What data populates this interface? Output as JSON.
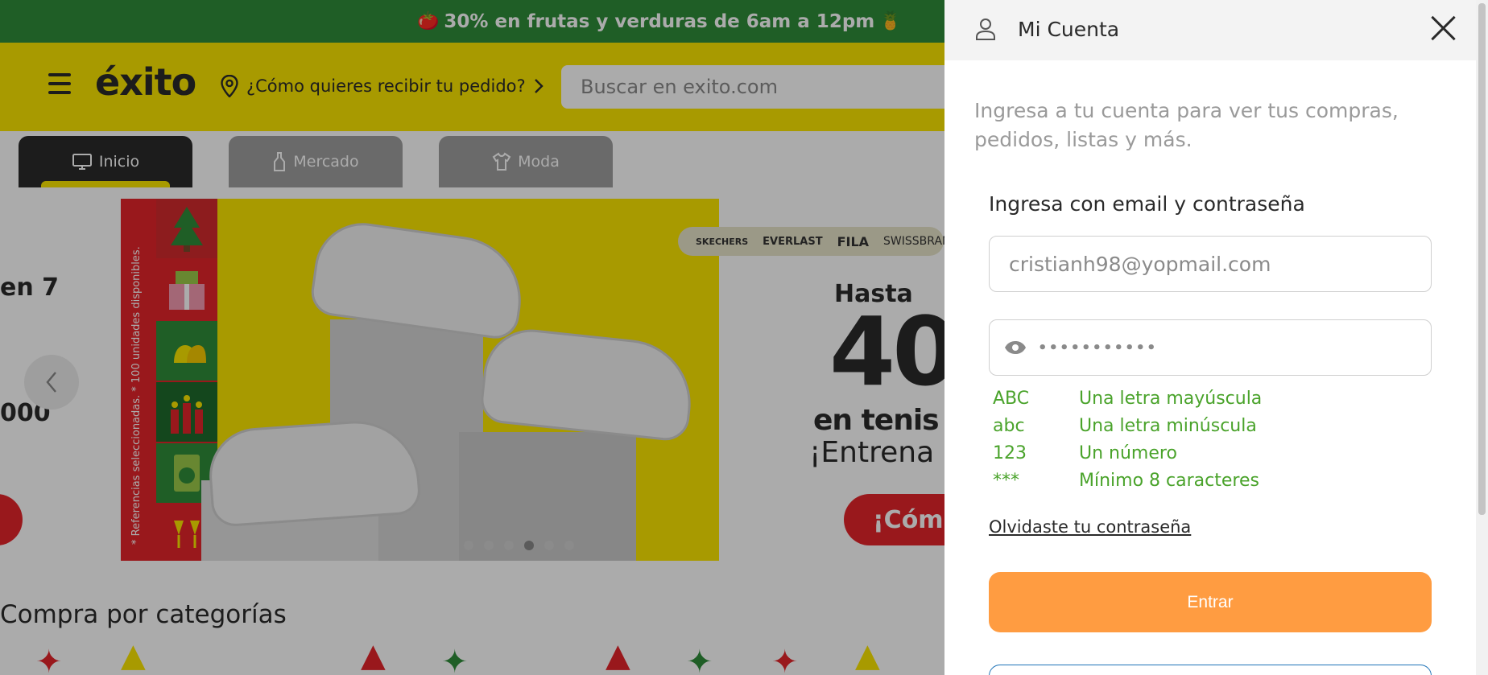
{
  "promo_bar": {
    "text": "30% en frutas y verduras de 6am a 12pm",
    "lead_emoji": "🍅",
    "tail_emoji": "🍍"
  },
  "header": {
    "logo": "éxito",
    "delivery_prompt": "¿Cómo quieres recibir tu pedido?",
    "search_placeholder": "Buscar en exito.com"
  },
  "tabs": [
    {
      "label": "Inicio",
      "icon": "monitor-icon",
      "active": true
    },
    {
      "label": "Mercado",
      "icon": "bottle-icon",
      "active": false
    },
    {
      "label": "Moda",
      "icon": "shirt-icon",
      "active": false
    }
  ],
  "banner": {
    "strip_text": "* Referencias seleccionadas. * 100 unidades disponibles.",
    "brands": [
      "SKECHERS",
      "EVERLAST",
      "FILA",
      "SWISSBRAND"
    ],
    "hasta": "Hasta",
    "percent": "40",
    "tenis": "en tenis de",
    "entrena": "¡Entrena c",
    "cta": "¡Cóm",
    "dots_total": 6,
    "dots_active": 4
  },
  "left_peek": {
    "line1": "en 7",
    "line2": "000"
  },
  "categories_title": "Compra por categorías",
  "panel": {
    "title": "Mi Cuenta",
    "intro": "Ingresa a tu cuenta para ver tus compras, pedidos, listas y más.",
    "login_heading": "Ingresa con email y contraseña",
    "email_value": "cristianh98@yopmail.com",
    "password_mask": "•••••••••••",
    "rules": [
      {
        "code": "ABC",
        "text": "Una letra mayúscula"
      },
      {
        "code": "abc",
        "text": "Una letra minúscula"
      },
      {
        "code": "123",
        "text": "Un número"
      },
      {
        "code": "***",
        "text": "Mínimo 8 caracteres"
      }
    ],
    "forgot_link": "Olvidaste tu contraseña",
    "enter_button": "Entrar"
  },
  "colors": {
    "promo_green": "#2f8c3a",
    "brand_yellow": "#fbe600",
    "brand_red": "#e5252b",
    "enter_orange": "#ff9c41",
    "rule_green": "#4aa32b"
  }
}
